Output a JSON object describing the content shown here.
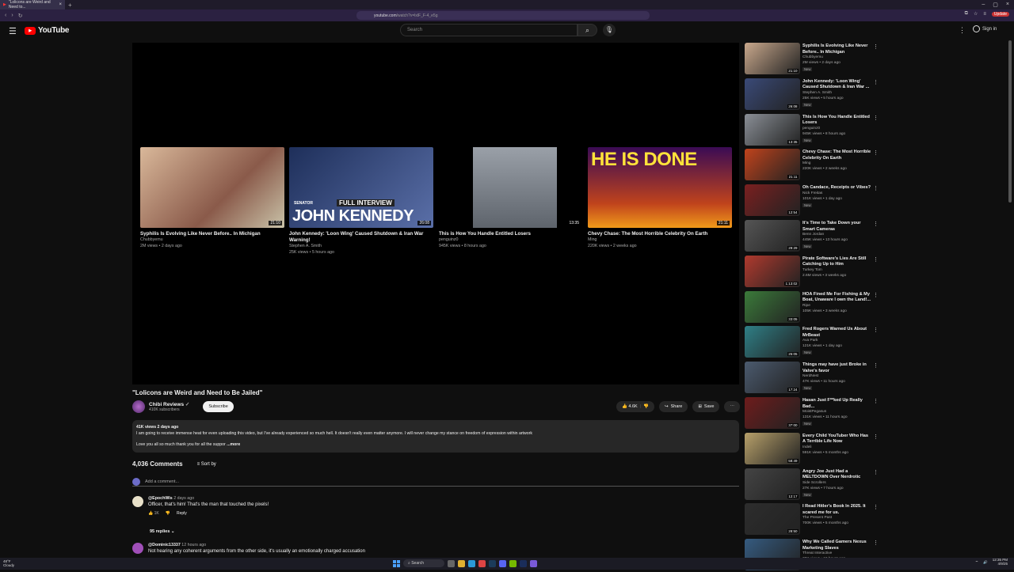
{
  "browser": {
    "tab_title": "\"Lolicons are Weird and Need to...",
    "url_host": "youtube.com",
    "url_path": "/watch?v=lxlF_F-4_e5g",
    "update_label": "Update"
  },
  "header": {
    "logo": "YouTube",
    "search_placeholder": "Search",
    "signin": "Sign in"
  },
  "endcards": [
    {
      "title": "Syphilis Is Evolving Like Never Before.. In Michigan",
      "channel": "Chubbyemu",
      "meta": "2M views • 2 days ago",
      "duration": "21:10",
      "color": "#c9a88c"
    },
    {
      "title": "John Kennedy: 'Loon Wing' Caused Shutdown & Iran War Warning!",
      "channel": "Stephen A. Smith",
      "meta": "25K views • 5 hours ago",
      "duration": "26:08",
      "color": "#3a4a78",
      "overlay_top": "FULL INTERVIEW",
      "overlay_main": "JOHN KENNEDY",
      "overlay_small": "SENATOR"
    },
    {
      "title": "This is How You Handle Entitled Losers",
      "channel": "penguinz0",
      "meta": "945K views • 8 hours ago",
      "duration": "13:35",
      "color": "#8a8f96"
    },
    {
      "title": "Chevy Chase: The Most Horrible Celebrity On Earth",
      "channel": "Ming",
      "meta": "220K views • 2 weeks ago",
      "duration": "21:11",
      "color": "#c0431c",
      "overlay_main": "HE IS DONE"
    }
  ],
  "video": {
    "title": "\"Lolicons are Weird and Need to Be Jailed\"",
    "channel": "Chibi Reviews",
    "subscribers": "410K subscribers",
    "subscribe": "Subscribe",
    "likes": "4.6K",
    "share": "Share",
    "save": "Save",
    "more": "⋯"
  },
  "description": {
    "stats": "41K views  2 days ago",
    "line1": "I am going to receive immense heat for even uploading this video, but I've already experienced so much hell. It doesn't really even matter anymore. I will never change my stance on freedom of expression within artwork",
    "line2": "Love you all so much thank you for all the suppor",
    "more": "...more"
  },
  "comments_header": {
    "count": "4,036 Comments",
    "sort": "Sort by",
    "add": "Add a comment..."
  },
  "comments": [
    {
      "user": "@EpochWis",
      "ago": "2 days ago",
      "text": "Officer, that's him! That's the man that touched the pixels!",
      "likes": "1K",
      "reply": "Reply",
      "replies": "95 replies"
    },
    {
      "user": "@Dominic13337",
      "ago": "12 hours ago",
      "text": "Not hearing any coherent arguments from the other side, it's usually an emotionally charged accusation"
    }
  ],
  "sidebar": [
    {
      "title": "Syphilis Is Evolving Like Never Before.. In Michigan",
      "channel": "Chubbyemu",
      "views": "2M views • 2 days ago",
      "dur": "21:10",
      "new": true,
      "color": "#c9a88c"
    },
    {
      "title": "John Kennedy: 'Loon Wing' Caused Shutdown & Iran War ...",
      "channel": "Stephen A. Smith",
      "views": "25K views • 5 hours ago",
      "dur": "26:08",
      "new": true,
      "color": "#3a4a78"
    },
    {
      "title": "This Is How You Handle Entitled Losers",
      "channel": "penguinz0",
      "views": "945K views • 8 hours ago",
      "dur": "13:35",
      "new": true,
      "color": "#8a8f96"
    },
    {
      "title": "Chevy Chase: The Most Horrible Celebrity On Earth",
      "channel": "Ming",
      "views": "220K views • 2 weeks ago",
      "dur": "21:11",
      "new": false,
      "color": "#c0431c"
    },
    {
      "title": "Oh Candace, Receipts or Vibes?",
      "channel": "Nick Freitas",
      "views": "101K views • 1 day ago",
      "dur": "12:54",
      "new": true,
      "color": "#7a2020"
    },
    {
      "title": "It's Time to Take Down your Smart Cameras",
      "channel": "Benn Jordan",
      "views": "445K views • 13 hours ago",
      "dur": "29:29",
      "new": true,
      "color": "#555"
    },
    {
      "title": "Pirate Software's Lies Are Still Catching Up to Him",
      "channel": "Turkey Tom",
      "views": "2.6M views • 3 weeks ago",
      "dur": "1:13:02",
      "new": false,
      "color": "#b03a2e"
    },
    {
      "title": "HOA Fined Me For Fishing & My Boat, Unaware I own the Land!...",
      "channel": "Ripe",
      "views": "105K views • 3 weeks ago",
      "dur": "33:05",
      "new": false,
      "color": "#3b7a3a"
    },
    {
      "title": "Fred Rogers Warned Us About MrBeast",
      "channel": "Ava Park",
      "views": "121K views • 1 day ago",
      "dur": "25:05",
      "new": true,
      "color": "#2f7f86"
    },
    {
      "title": "Things may have just Broke in Valve's favor",
      "channel": "NerdNest",
      "views": "47K views • 11 hours ago",
      "dur": "17:24",
      "new": true,
      "color": "#4b5a6e"
    },
    {
      "title": "Hasan Just F**ked Up Really Bad...",
      "channel": "MoistPegasus",
      "views": "131K views • 11 hours ago",
      "dur": "37:00",
      "new": true,
      "color": "#6e1c1c"
    },
    {
      "title": "Every Child YouTuber Who Has A Terrible Life Now",
      "channel": "Indeli",
      "views": "591K views • 5 months ago",
      "dur": "58:49",
      "new": false,
      "color": "#b7a06a"
    },
    {
      "title": "Angry Joe Just Had a MELTDOWN Over Nerdrotic",
      "channel": "Side Scrollers",
      "views": "27K views • 7 hours ago",
      "dur": "12:17",
      "new": true,
      "color": "#444"
    },
    {
      "title": "I Read Hitler's Book In 2025. It scared me for us.",
      "channel": "The Present Past",
      "views": "700K views • 5 months ago",
      "dur": "28:50",
      "new": false,
      "color": "#2d2d2d"
    },
    {
      "title": "Why We Called Gamers Nexus Marketing Slaves",
      "channel": "Threat Interactive",
      "views": "38K views • 19 hours ago",
      "dur": "",
      "new": false,
      "color": "#355b80"
    }
  ],
  "new_badge": "New",
  "taskbar": {
    "weather_temp": "48°F",
    "weather_desc": "Cloudy",
    "search": "Search",
    "time": "12:35 PM",
    "date": "4/9/25"
  }
}
